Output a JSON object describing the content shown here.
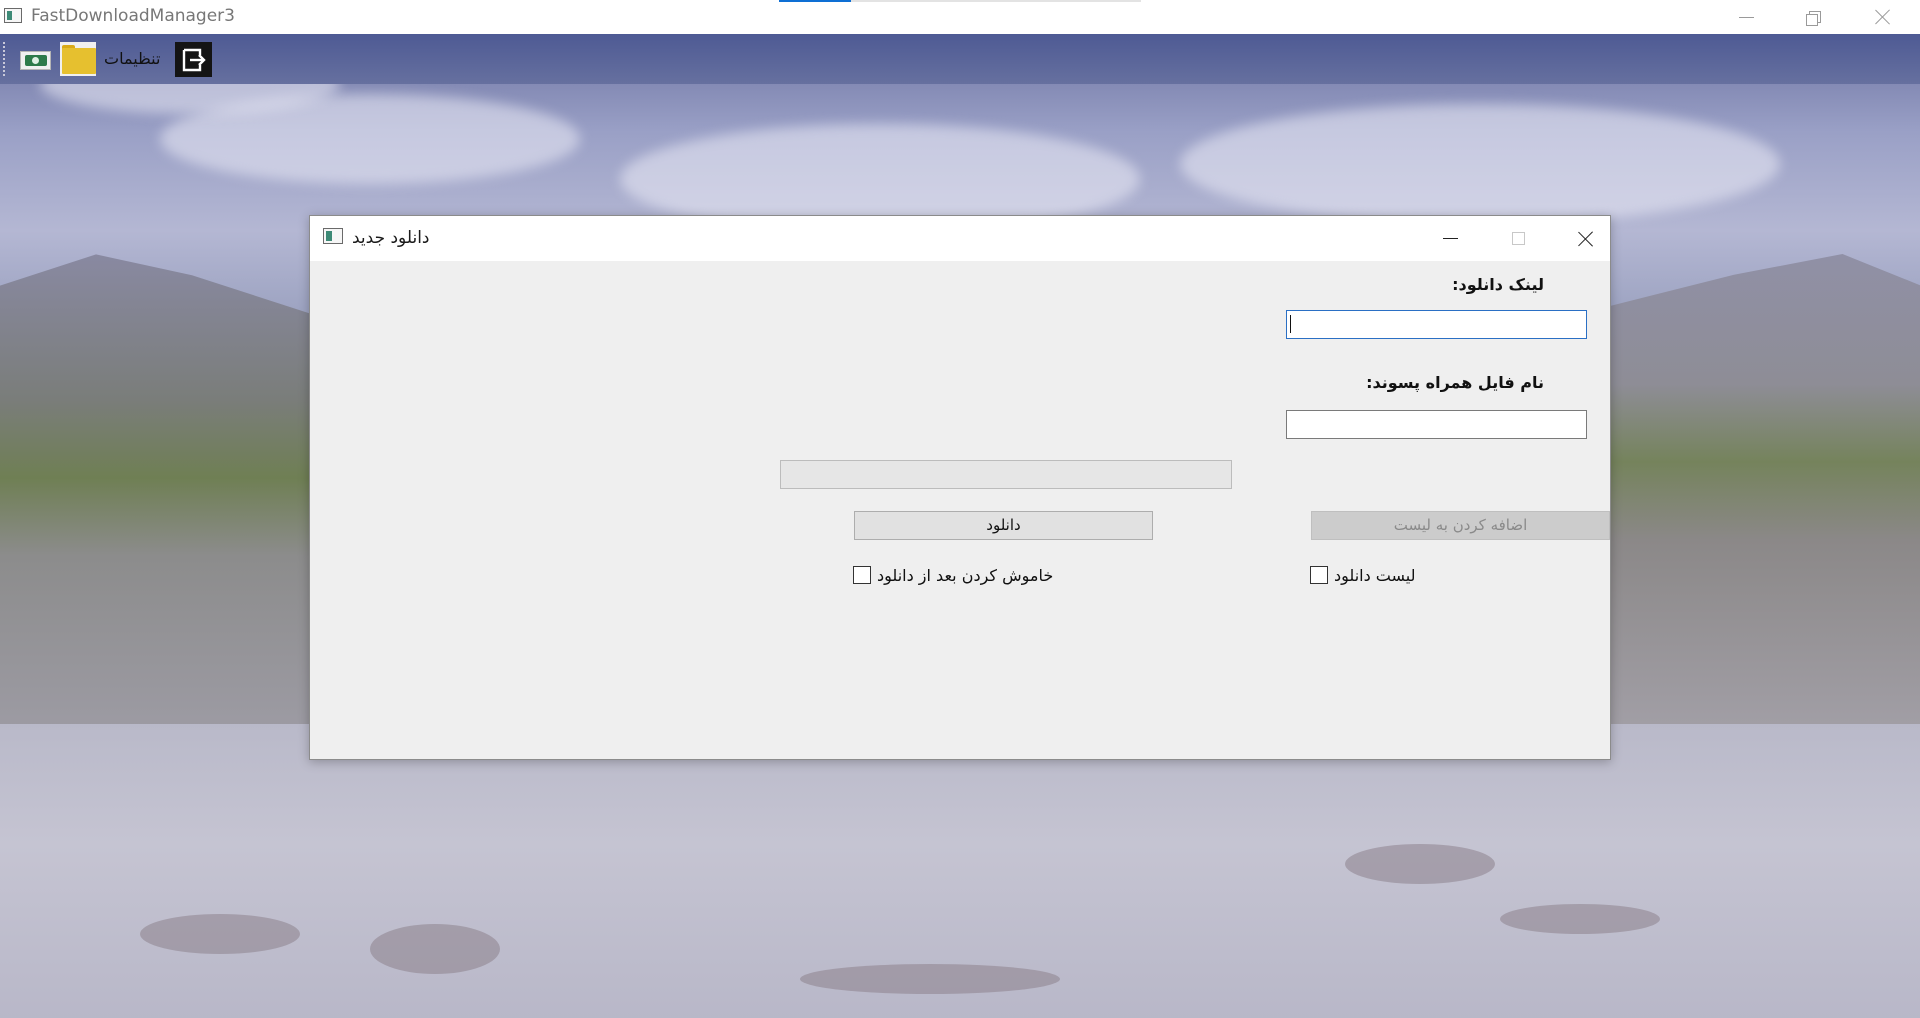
{
  "app": {
    "title": "FastDownloadManager3"
  },
  "toolbar": {
    "settings_label": "تنظیمات",
    "icons": [
      "money-icon",
      "folder-icon",
      "exit-icon"
    ]
  },
  "dialog": {
    "title": "دانلود جدید",
    "link_label": "لینک دانلود:",
    "link_value": "",
    "filename_label": "نام فایل همراه پسوند:",
    "filename_value": "",
    "progress": 0,
    "download_button": "دانلود",
    "add_to_list_button": "اضافه کردن به لیست",
    "add_to_list_enabled": false,
    "shutdown_checkbox_label": "خاموش کردن بعد از دانلود",
    "shutdown_checked": false,
    "download_list_checkbox_label": "لیست دانلود",
    "download_list_checked": false
  },
  "colors": {
    "accent": "#0e6fd4",
    "toolbar_bg": "#4e5a94",
    "dialog_bg": "#efefef",
    "disabled_button_bg": "#cccccc"
  }
}
